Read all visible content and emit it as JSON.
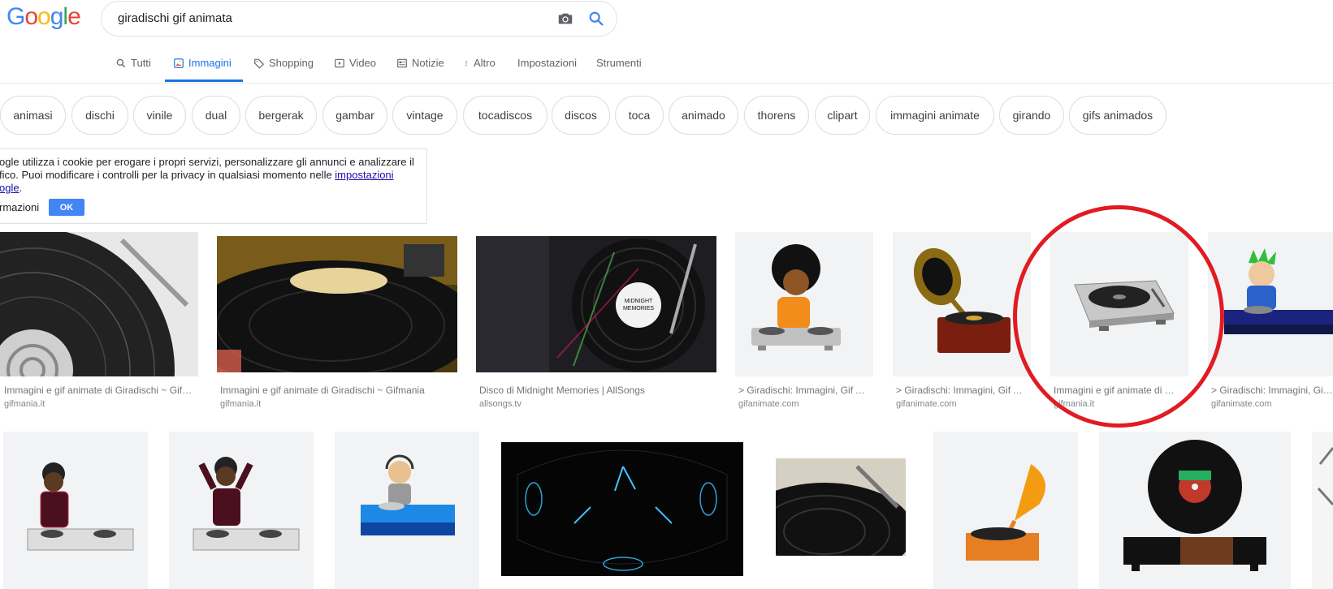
{
  "header": {
    "logo_letters": [
      {
        "ch": "G",
        "color": "#4285f4"
      },
      {
        "ch": "o",
        "color": "#ea4335"
      },
      {
        "ch": "o",
        "color": "#fbbc05"
      },
      {
        "ch": "g",
        "color": "#4285f4"
      },
      {
        "ch": "l",
        "color": "#34a853"
      },
      {
        "ch": "e",
        "color": "#ea4335"
      }
    ],
    "query": "giradischi gif animata"
  },
  "tabs": [
    {
      "label": "Tutti",
      "icon": "search-icon"
    },
    {
      "label": "Immagini",
      "icon": "image-icon",
      "active": true
    },
    {
      "label": "Shopping",
      "icon": "tag-icon"
    },
    {
      "label": "Video",
      "icon": "play-icon"
    },
    {
      "label": "Notizie",
      "icon": "news-icon"
    },
    {
      "label": "Altro",
      "icon": "more-vert-icon"
    },
    {
      "label": "Impostazioni"
    },
    {
      "label": "Strumenti"
    }
  ],
  "chips": [
    "animasi",
    "dischi",
    "vinile",
    "dual",
    "bergerak",
    "gambar",
    "vintage",
    "tocadiscos",
    "discos",
    "toca",
    "animado",
    "thorens",
    "clipart",
    "immagini animate",
    "girando",
    "gifs animados"
  ],
  "cookie": {
    "line1": "ogle utilizza i cookie per erogare i propri servizi, personalizzare gli annunci e analizzare il",
    "line2_a": "fico. Puoi modificare i controlli per la privacy in qualsiasi momento nelle ",
    "line2_link": "impostazioni",
    "line3_link": "ogle",
    "line3_b": ".",
    "more": "rmazioni",
    "ok": "OK"
  },
  "results_row1": [
    {
      "caption": "Immagini e gif animate di Giradischi ~ Gifmania",
      "site": "gifmania.it"
    },
    {
      "caption": "Immagini e gif animate di Giradischi ~ Gifmania",
      "site": "gifmania.it"
    },
    {
      "caption": "Disco di Midnight Memories | AllSongs",
      "site": "allsongs.tv"
    },
    {
      "caption": "> Giradischi: Immagini, Gif Animate",
      "site": "gifanimate.com"
    },
    {
      "caption": "> Giradischi: Immagini, Gif Animate",
      "site": "gifanimate.com"
    },
    {
      "caption": "Immagini e gif animate di Giradischi",
      "site": "gifmania.it"
    },
    {
      "caption": "> Giradischi: Immagini, Gif Animate",
      "site": "gifanimate.com"
    }
  ],
  "thumb_text": {
    "record_label_line1": "MIDNIGHT",
    "record_label_line2": "MEMORIES"
  },
  "colors": {
    "accent": "#1a73e8",
    "annotation": "#e11b22"
  }
}
